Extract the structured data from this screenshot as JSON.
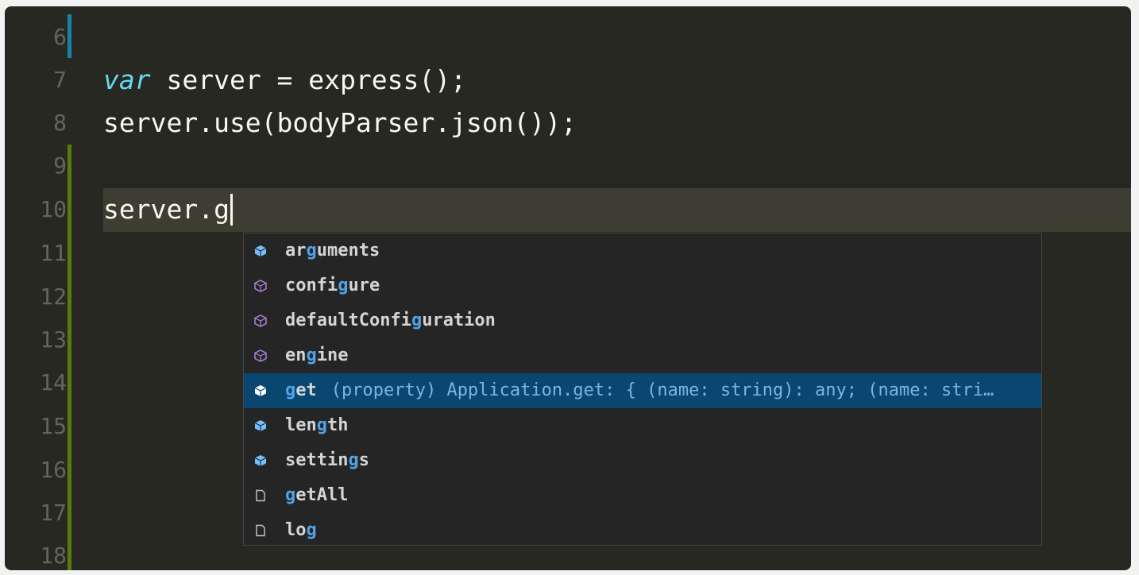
{
  "editor": {
    "line_numbers": [
      "6",
      "7",
      "8",
      "9",
      "10",
      "11",
      "12",
      "13",
      "14",
      "15",
      "16",
      "17",
      "18"
    ],
    "code": {
      "line7_kw": "var",
      "line7_rest": " server = express();",
      "line8": "server.use(bodyParser.json());",
      "line10": "server.g"
    }
  },
  "suggest": {
    "items": [
      {
        "pre": "ar",
        "match": "g",
        "post": "uments",
        "icon": "property-icon"
      },
      {
        "pre": "confi",
        "match": "g",
        "post": "ure",
        "icon": "method-icon"
      },
      {
        "pre": "defaultConfi",
        "match": "g",
        "post": "uration",
        "icon": "method-icon"
      },
      {
        "pre": "en",
        "match": "g",
        "post": "ine",
        "icon": "method-icon"
      },
      {
        "pre": "",
        "match": "g",
        "post": "et",
        "icon": "property-icon",
        "detail": "(property) Application.get: { (name: string): any; (name: stri…"
      },
      {
        "pre": "len",
        "match": "g",
        "post": "th",
        "icon": "property-icon"
      },
      {
        "pre": "settin",
        "match": "g",
        "post": "s",
        "icon": "property-icon"
      },
      {
        "pre": "",
        "match": "g",
        "post": "etAll",
        "icon": "file-icon"
      },
      {
        "pre": "lo",
        "match": "g",
        "post": "",
        "icon": "file-icon"
      }
    ],
    "selected_index": 4
  },
  "colors": {
    "background": "#272822",
    "keyword": "#66d9ef",
    "match_highlight": "#4fa3e8",
    "selection": "#094771",
    "git_modified": "#1b81a8",
    "git_added": "#587c0c"
  }
}
